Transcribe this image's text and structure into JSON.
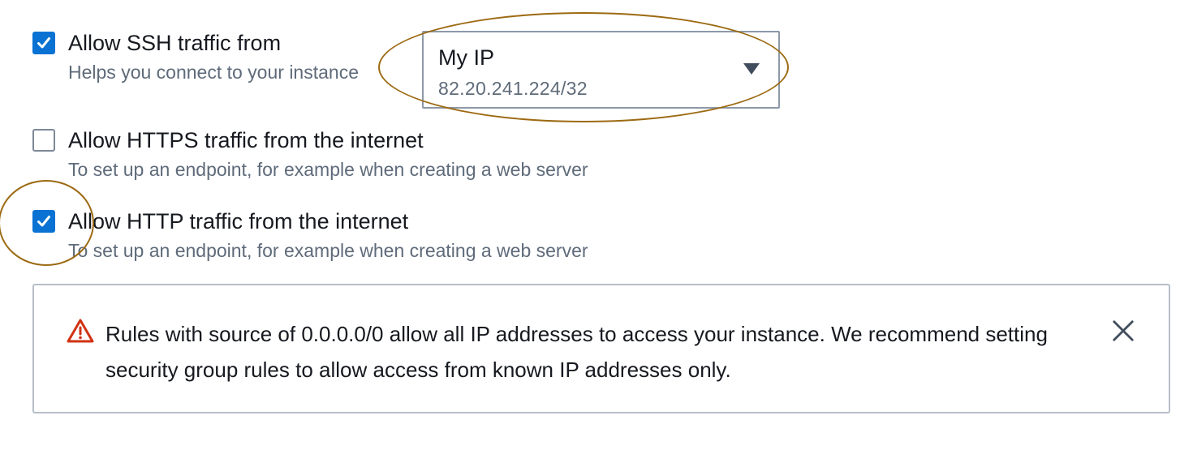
{
  "rules": [
    {
      "checked": true,
      "label": "Allow SSH traffic from",
      "description": "Helps you connect to your instance"
    },
    {
      "checked": false,
      "label": "Allow HTTPS traffic from the internet",
      "description": "To set up an endpoint, for example when creating a web server"
    },
    {
      "checked": true,
      "label": "Allow HTTP traffic from the internet",
      "description": "To set up an endpoint, for example when creating a web server"
    }
  ],
  "ssh_source": {
    "value": "My IP",
    "detail": "82.20.241.224/32",
    "icon": "caret-down-icon"
  },
  "warning": {
    "icon": "warning-triangle-icon",
    "text": "Rules with source of 0.0.0.0/0 allow all IP addresses to access your instance. We recommend setting security group rules to allow access from known IP addresses only.",
    "close_icon": "close-icon"
  },
  "colors": {
    "checkbox_checked": "#0972d3",
    "warning_icon": "#d13212",
    "annotation": "#9c6a12"
  }
}
